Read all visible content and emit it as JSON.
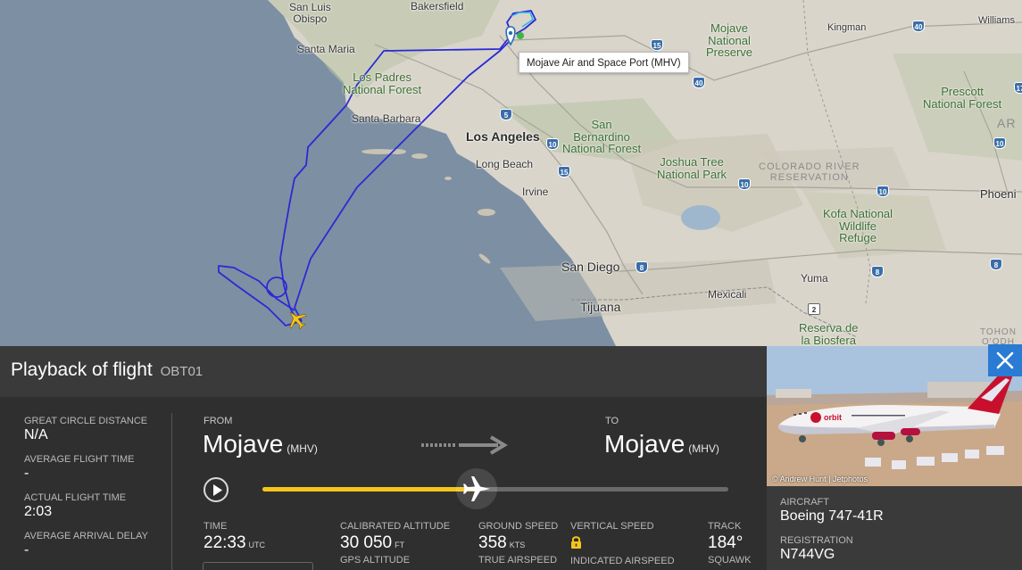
{
  "map": {
    "labels": {
      "bakersfield": "Bakersfield",
      "san_luis_obispo": "San Luis\nObispo",
      "santa_maria": "Santa Maria",
      "los_padres": "Los Padres\nNational Forest",
      "santa_barbara": "Santa Barbara",
      "los_angeles": "Los Angeles",
      "long_beach": "Long Beach",
      "irvine": "Irvine",
      "san_bernardino": "San\nBernardino\nNational Forest",
      "joshua_tree": "Joshua Tree\nNational Park",
      "mojave_preserve": "Mojave\nNational\nPreserve",
      "kingman": "Kingman",
      "williams": "Williams",
      "prescott": "Prescott\nNational Forest",
      "ar": "AR",
      "colorado_river": "COLORADO RIVER\nRESERVATION",
      "phoenix": "Phoeni",
      "kofa": "Kofa National\nWildlife\nRefuge",
      "san_diego": "San Diego",
      "tijuana": "Tijuana",
      "mexicali": "Mexicali",
      "yuma": "Yuma",
      "reserva": "Reserva de\nla Biosfera",
      "tohono": "TOHON\nO'ODH"
    },
    "highways": [
      "15",
      "40",
      "40",
      "10",
      "10",
      "15",
      "8",
      "8",
      "10",
      "10",
      "8",
      "17",
      "2",
      "5"
    ],
    "airport_tooltip": "Mojave Air and Space Port (MHV)",
    "colors": {
      "track": "#2a2ad6",
      "aircraft": "#f5c518",
      "ocean": "#7b8fa3"
    }
  },
  "panel": {
    "title": "Playback of flight",
    "flight_id": "OBT01",
    "stats": {
      "great_circle_label": "GREAT CIRCLE DISTANCE",
      "great_circle_value": "N/A",
      "avg_flight_label": "AVERAGE FLIGHT TIME",
      "avg_flight_value": "-",
      "actual_flight_label": "ACTUAL FLIGHT TIME",
      "actual_flight_value": "2:03",
      "avg_delay_label": "AVERAGE ARRIVAL DELAY",
      "avg_delay_value": "-"
    },
    "route": {
      "from_label": "FROM",
      "from_city": "Mojave",
      "from_code": "(MHV)",
      "to_label": "TO",
      "to_city": "Mojave",
      "to_code": "(MHV)"
    },
    "playback": {
      "progress": 0.46
    },
    "data": {
      "time_label": "TIME",
      "time_value": "22:33",
      "time_unit": "UTC",
      "cal_alt_label": "CALIBRATED ALTITUDE",
      "cal_alt_value": "30 050",
      "cal_alt_unit": "FT",
      "gps_alt_label": "GPS ALTITUDE",
      "ground_speed_label": "GROUND SPEED",
      "ground_speed_value": "358",
      "ground_speed_unit": "KTS",
      "true_airspeed_label": "TRUE AIRSPEED",
      "vert_speed_label": "VERTICAL SPEED",
      "indicated_airspeed_label": "INDICATED AIRSPEED",
      "track_label": "TRACK",
      "track_value": "184°",
      "squawk_label": "SQUAWK"
    }
  },
  "aircraft": {
    "photo_credit": "© Andrew Hunt | Jetphotos",
    "aircraft_label": "AIRCRAFT",
    "aircraft_value": "Boeing 747-41R",
    "registration_label": "REGISTRATION",
    "registration_value": "N744VG"
  }
}
